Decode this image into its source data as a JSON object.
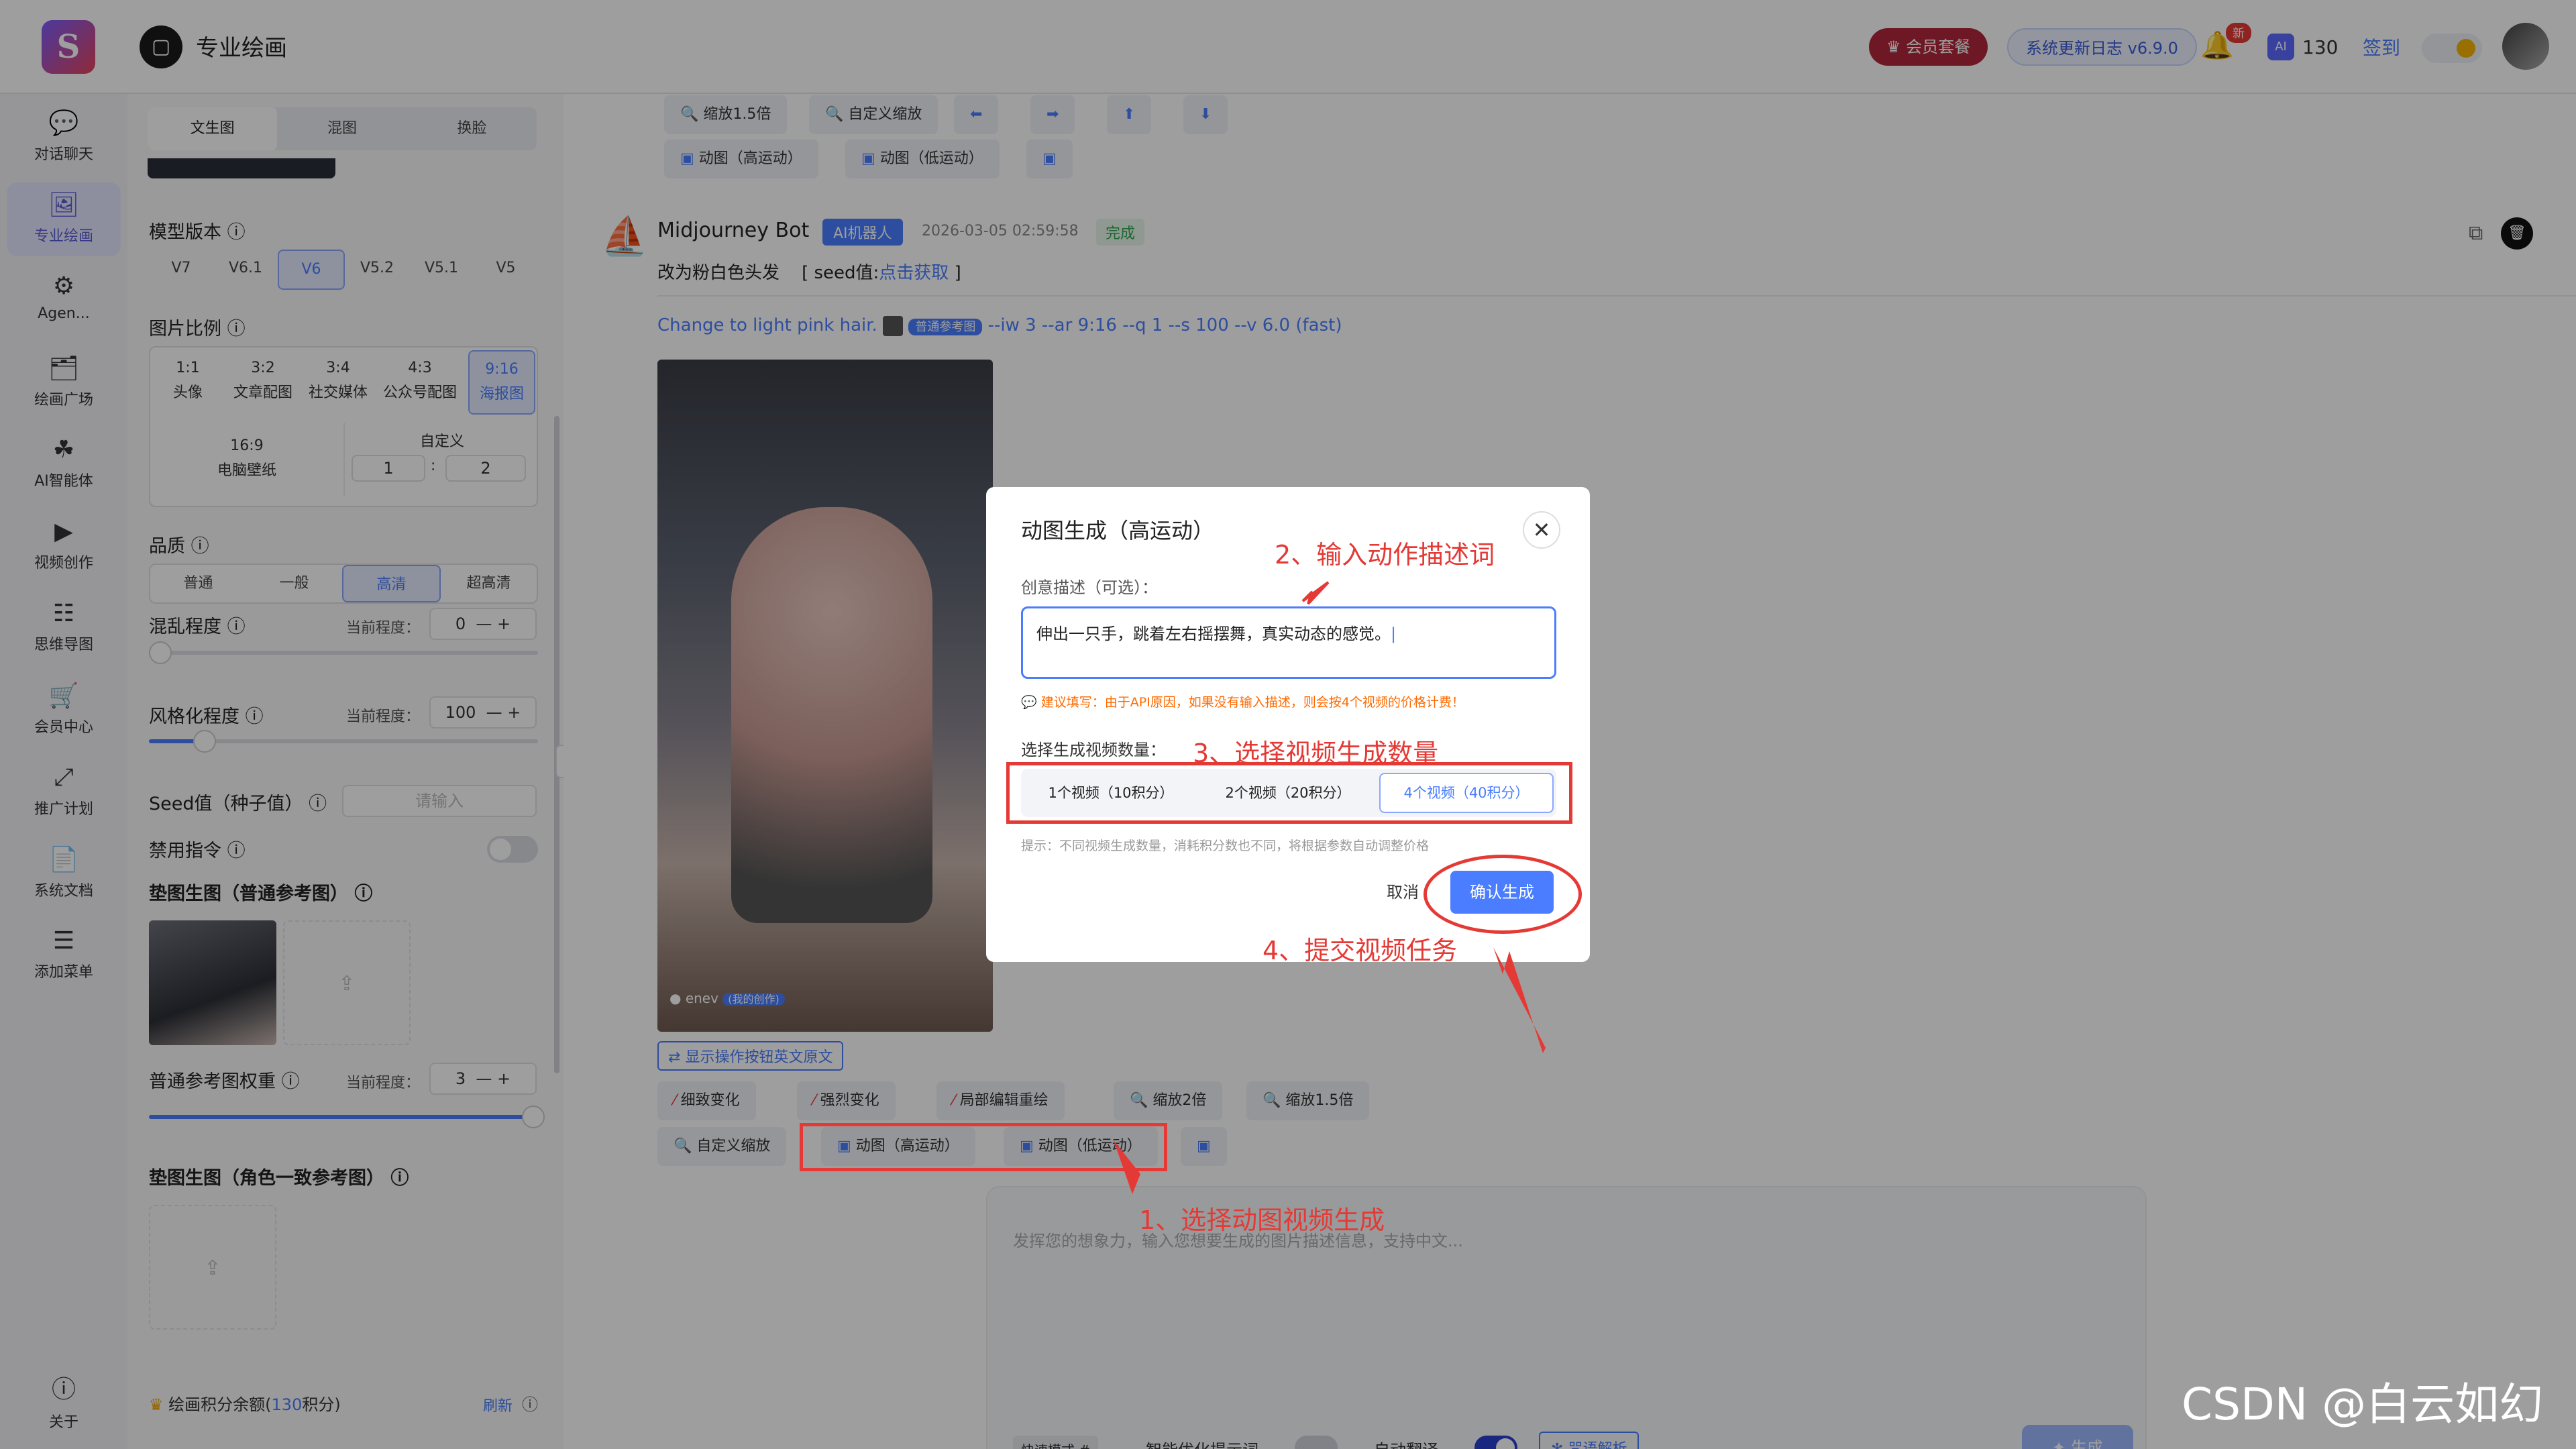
{
  "app": {
    "logo": "S",
    "title": "专业绘画",
    "title_icon": "panel-icon"
  },
  "topbar": {
    "vip": "会员套餐",
    "update": "系统更新日志 v6.9.0",
    "badge": "新",
    "credits": "130",
    "ai_label": "AI",
    "checkin": "签到"
  },
  "sidebar": [
    {
      "label": "对话聊天",
      "icon": "chat-icon"
    },
    {
      "label": "专业绘画",
      "icon": "paint-icon",
      "active": true
    },
    {
      "label": "Agen...",
      "icon": "agent-icon"
    },
    {
      "label": "绘画广场",
      "icon": "gallery-icon"
    },
    {
      "label": "AI智能体",
      "icon": "bot-icon"
    },
    {
      "label": "视频创作",
      "icon": "video-icon"
    },
    {
      "label": "思维导图",
      "icon": "mindmap-icon"
    },
    {
      "label": "会员中心",
      "icon": "cart-icon"
    },
    {
      "label": "推广计划",
      "icon": "share-icon"
    },
    {
      "label": "系统文档",
      "icon": "doc-icon"
    },
    {
      "label": "添加菜单",
      "icon": "menu-icon"
    },
    {
      "label": "关于",
      "icon": "info-icon"
    }
  ],
  "panel": {
    "tabs": [
      "文生图",
      "混图",
      "换脸"
    ],
    "model_label": "模型版本",
    "models": [
      "V7",
      "V6.1",
      "V6",
      "V5.2",
      "V5.1",
      "V5"
    ],
    "ratio_label": "图片比例",
    "ratios": [
      {
        "r": "1:1",
        "n": "头像"
      },
      {
        "r": "3:2",
        "n": "文章配图"
      },
      {
        "r": "3:4",
        "n": "社交媒体"
      },
      {
        "r": "4:3",
        "n": "公众号配图"
      },
      {
        "r": "9:16",
        "n": "海报图"
      }
    ],
    "ratio_wide": {
      "r": "16:9",
      "n": "电脑壁纸"
    },
    "ratio_custom": "自定义",
    "custom_w": "1",
    "custom_sep": ":",
    "custom_h": "2",
    "quality_label": "品质",
    "qualities": [
      "普通",
      "一般",
      "高清",
      "超高清"
    ],
    "chaos_label": "混乱程度",
    "current_level": "当前程度：",
    "chaos_value": "0",
    "stylize_label": "风格化程度",
    "stylize_value": "100",
    "seed_label": "Seed值（种子值）",
    "seed_placeholder": "请输入",
    "noword_label": "禁用指令",
    "ref_label": "垫图生图（普通参考图）",
    "weight_label": "普通参考图权重",
    "weight_value": "3",
    "role_label": "垫图生图（角色一致参考图）",
    "balance_prefix": "绘画积分余额(",
    "balance": "130",
    "balance_suffix": "积分)",
    "refresh": "刷新",
    "minus": "—",
    "plus": "+",
    "help": "ⓘ"
  },
  "content": {
    "top_row1": [
      "缩放1.5倍",
      "自定义缩放",
      "⬅",
      "➡",
      "⬆",
      "⬇"
    ],
    "top_row2": [
      "动图（高运动）",
      "动图（低运动）",
      "▣"
    ],
    "bot_name": "Midjourney Bot",
    "bot_tag": "AI机器人",
    "time": "2026-03-05 02:59:58",
    "status": "完成",
    "instruction": "改为粉白色头发",
    "seed_prefix": "[ seed值:",
    "seed_link": "点击获取",
    "seed_suffix": "]",
    "prompt_text": "Change to light pink hair.",
    "prompt_tag": "普通参考图",
    "prompt_params": "--iw 3 --ar 9:16 --q 1 --s 100 --v 6.0 (fast)",
    "image_user": "enev",
    "image_user_tag": "(我的创作)",
    "show_original": "显示操作按钮英文原文",
    "act_row1": [
      "细致变化",
      "强烈变化",
      "局部编辑重绘",
      "缩放2倍",
      "缩放1.5倍"
    ],
    "act_row2": [
      "自定义缩放",
      "动图（高运动）",
      "动图（低运动）",
      "▣"
    ],
    "input_placeholder": "发挥您的想象力，输入您想要生成的图片描述信息，支持中文...",
    "mode": "快速模式 #",
    "opt_label": "智能优化提示词",
    "translate_label": "自动翻译",
    "parse": "咒语解析",
    "generate": "生成",
    "watermark": "CSDN @白云如幻"
  },
  "modal": {
    "title": "动图生成（高运动）",
    "desc_label": "创意描述（可选）：",
    "desc_value": "伸出一只手，跳着左右摇摆舞，真实动态的感觉。",
    "tip": "建议填写：由于API原因，如果没有输入描述，则会按4个视频的价格计费！",
    "count_label": "选择生成视频数量：",
    "options": [
      "1个视频（10积分）",
      "2个视频（20积分）",
      "4个视频（40积分）"
    ],
    "hint": "提示：不同视频生成数量，消耗积分数也不同，将根据参数自动调整价格",
    "cancel": "取消",
    "confirm": "确认生成"
  },
  "annotations": [
    "1、选择动图视频生成",
    "2、输入动作描述词",
    "3、选择视频生成数量",
    "4、提交视频任务"
  ],
  "colors": {
    "accent": "#4a7dff",
    "annotation": "#e53935",
    "active_nav": "#5b5bd6"
  }
}
